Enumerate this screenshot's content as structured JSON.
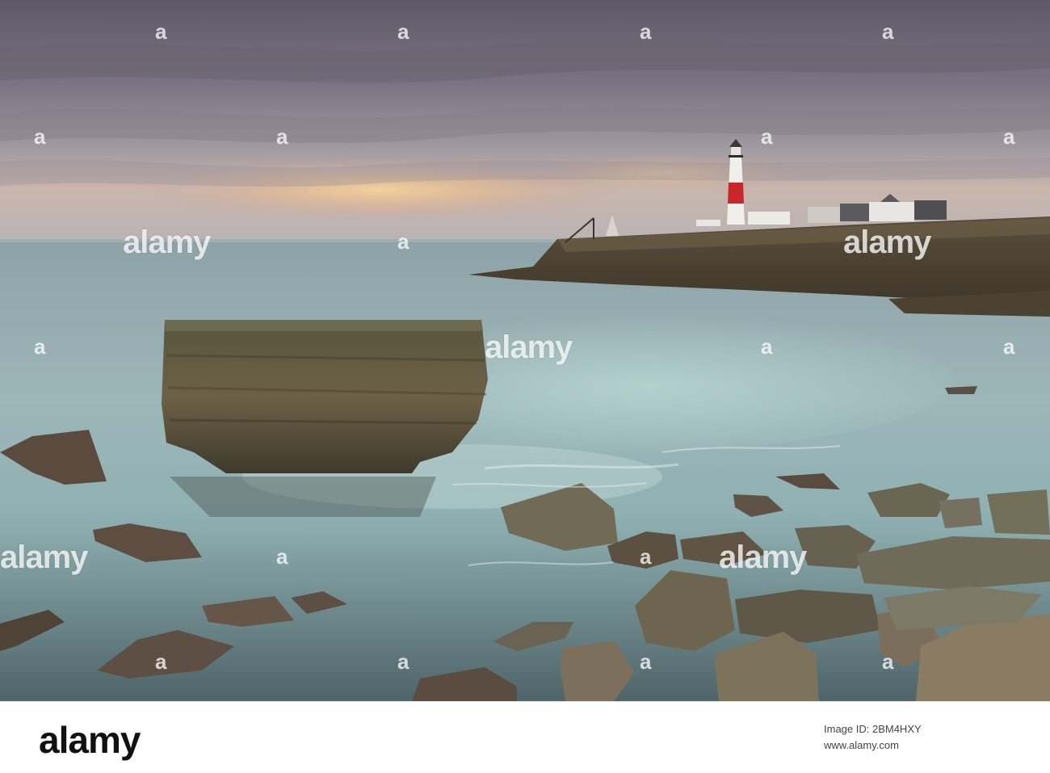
{
  "watermark": {
    "brand": "alamy",
    "small_mark": "a"
  },
  "footer": {
    "logo": "alamy",
    "image_id_line": "Image ID: 2BM4HXY",
    "site": "www.alamy.com"
  },
  "scene": {
    "subject": "lighthouse",
    "palette": {
      "sky_top": "#6e6674",
      "sky_glow": "#e9c08f",
      "sea": "#7f9aa1",
      "rock": "#5c5440",
      "lighthouse_red": "#c8272c"
    }
  }
}
